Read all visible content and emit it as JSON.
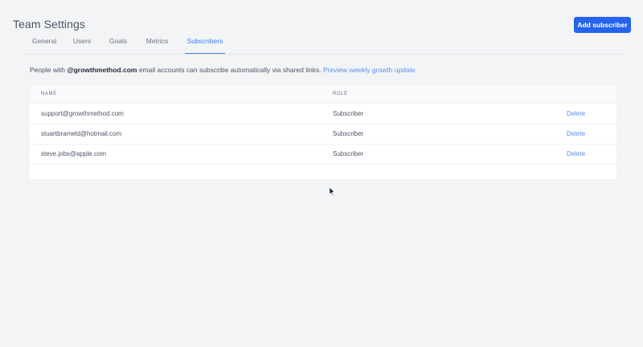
{
  "header": {
    "title": "Team Settings",
    "add_button_label": "Add subscriber"
  },
  "tabs": [
    {
      "label": "General",
      "active": false
    },
    {
      "label": "Users",
      "active": false
    },
    {
      "label": "Goals",
      "active": false
    },
    {
      "label": "Metrics",
      "active": false
    },
    {
      "label": "Subscribers",
      "active": true
    }
  ],
  "info": {
    "prefix": "People with ",
    "domain": "@growthmethod.com",
    "suffix": " email accounts can subscribe automatically via shared links. ",
    "link_label": "Preview weekly growth update"
  },
  "table": {
    "headers": {
      "name": "NAME",
      "role": "ROLE"
    },
    "rows": [
      {
        "email": "support@growthmethod.com",
        "role": "Subscriber",
        "action": "Delete"
      },
      {
        "email": "stuartbrameld@hotmail.com",
        "role": "Subscriber",
        "action": "Delete"
      },
      {
        "email": "steve.jobs@apple.com",
        "role": "Subscriber",
        "action": "Delete"
      }
    ]
  },
  "colors": {
    "accent": "#2563eb",
    "link": "#5b8def",
    "background": "#f3f4f6"
  }
}
